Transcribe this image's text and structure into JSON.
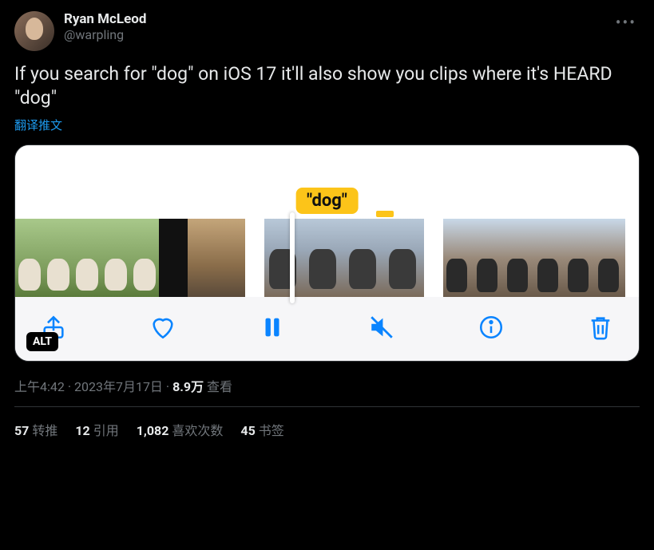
{
  "author": {
    "display_name": "Ryan McLeod",
    "handle": "@warpling"
  },
  "tweet_text": "If you search for \"dog\" on iOS 17 it'll also show you clips where it's HEARD \"dog\"",
  "translate_label": "翻译推文",
  "media": {
    "caption_keyword": "\"dog\"",
    "alt_badge": "ALT",
    "toolbar_icons": {
      "share": "share-icon",
      "heart": "heart-icon",
      "pause": "pause-icon",
      "mute": "mute-icon",
      "info": "info-icon",
      "trash": "trash-icon"
    }
  },
  "meta": {
    "time": "上午4:42",
    "sep1": " · ",
    "date": "2023年7月17日",
    "sep2": " · ",
    "views_count": "8.9万",
    "views_label": " 查看"
  },
  "stats": {
    "retweets_count": "57",
    "retweets_label": "转推",
    "quotes_count": "12",
    "quotes_label": "引用",
    "likes_count": "1,082",
    "likes_label": "喜欢次数",
    "bookmarks_count": "45",
    "bookmarks_label": "书签"
  }
}
